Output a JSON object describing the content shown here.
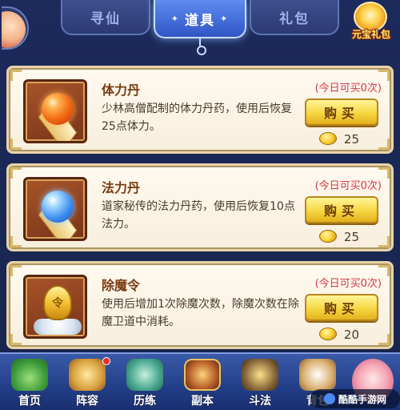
{
  "tabs": [
    {
      "label": "寻仙",
      "active": false
    },
    {
      "label": "道具",
      "active": true
    },
    {
      "label": "礼包",
      "active": false
    }
  ],
  "gift_button": {
    "label": "元宝礼包"
  },
  "items": [
    {
      "name": "体力丹",
      "icon": "red-pill-icon",
      "description": "少林高僧配制的体力丹药，使用后恢复25点体力。",
      "limit": "(今日可买0次)",
      "buy_label": "购买",
      "price": "25"
    },
    {
      "name": "法力丹",
      "icon": "blue-pill-icon",
      "description": "道家秘传的法力丹药，使用后恢复10点法力。",
      "limit": "(今日可买0次)",
      "buy_label": "购买",
      "price": "25"
    },
    {
      "name": "除魔令",
      "icon": "demon-token-icon",
      "description": "使用后增加1次除魔次数，除魔次数在除魔卫道中消耗。",
      "limit": "(今日可买0次)",
      "buy_label": "购买",
      "price": "20"
    }
  ],
  "bottom_nav": [
    {
      "label": "首页",
      "icon": "home-icon"
    },
    {
      "label": "阵容",
      "icon": "lineup-icon",
      "badge": true
    },
    {
      "label": "历练",
      "icon": "training-icon"
    },
    {
      "label": "副本",
      "icon": "dungeon-icon"
    },
    {
      "label": "斗法",
      "icon": "battle-icon"
    },
    {
      "label": "背包",
      "icon": "bag-icon"
    },
    {
      "label": "",
      "icon": "character-icon"
    }
  ],
  "watermark": "酷酷手游网",
  "colors": {
    "background": "#1c2a5c",
    "tab_active": "#2f55c6",
    "card_bg": "#fffaf0",
    "item_name": "#7a3a10",
    "limit_text": "#d2384a",
    "buy_button": "#f6d642"
  }
}
